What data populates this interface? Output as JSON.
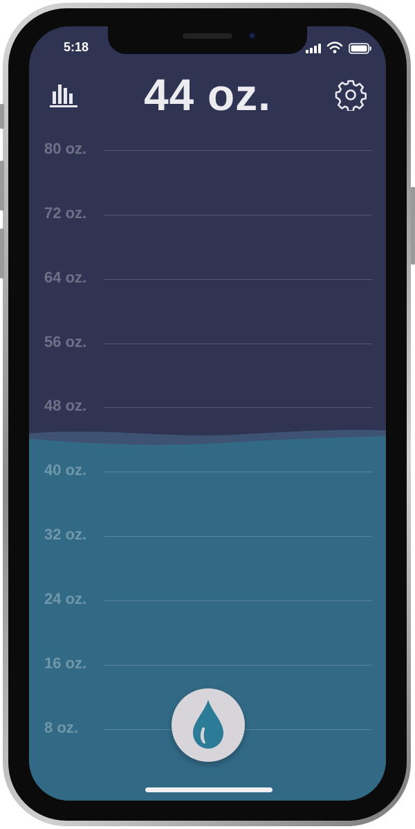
{
  "status_bar": {
    "time": "5:18"
  },
  "header": {
    "total": "44 oz.",
    "stats_icon": "bar-chart-icon",
    "settings_icon": "gear-icon"
  },
  "intake": {
    "level_oz": 44,
    "max_oz": 84
  },
  "scale": {
    "labels": [
      "80 oz.",
      "72 oz.",
      "64 oz.",
      "56 oz.",
      "48 oz.",
      "40 oz.",
      "32 oz.",
      "24 oz.",
      "16 oz.",
      "8 oz."
    ]
  },
  "actions": {
    "add_water_icon": "water-drop-icon"
  },
  "colors": {
    "background": "#2f3453",
    "water_back": "#3e5373",
    "water_front": "#326a86",
    "drop_button_bg": "#d8d5da",
    "drop": "#2c7c97"
  }
}
